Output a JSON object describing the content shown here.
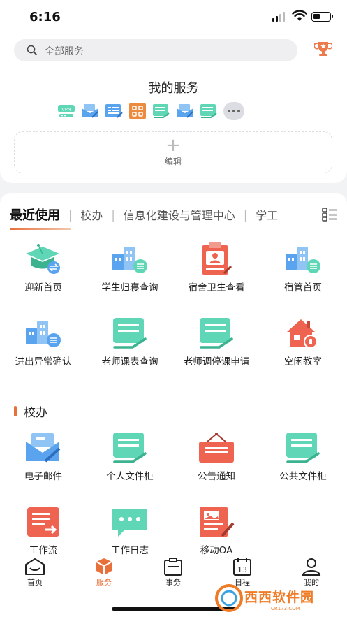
{
  "status_bar": {
    "time": "6:16"
  },
  "search": {
    "placeholder": "全部服务"
  },
  "my_services": {
    "title": "我的服务",
    "icons": [
      "vpn-icon",
      "mail-icon",
      "form-icon",
      "apps-icon",
      "document-icon",
      "mail-icon",
      "document-icon"
    ],
    "edit_label": "编辑"
  },
  "tabs": {
    "items": [
      {
        "label": "最近使用",
        "active": true
      },
      {
        "label": "校办",
        "active": false
      },
      {
        "label": "信息化建设与管理中心",
        "active": false
      },
      {
        "label": "学工",
        "active": false
      }
    ]
  },
  "recent": {
    "items": [
      {
        "label": "迎新首页",
        "icon": "graduation-cap-icon"
      },
      {
        "label": "学生归寝查询",
        "icon": "dormitory-building-icon"
      },
      {
        "label": "宿舍卫生查看",
        "icon": "id-clipboard-icon"
      },
      {
        "label": "宿管首页",
        "icon": "dormitory-building-icon"
      },
      {
        "label": "进出异常确认",
        "icon": "dormitory-building-icon"
      },
      {
        "label": "老师课表查询",
        "icon": "document-hand-icon"
      },
      {
        "label": "老师调停课申请",
        "icon": "document-hand-icon"
      },
      {
        "label": "空闲教室",
        "icon": "house-lock-icon"
      }
    ]
  },
  "xiaoban": {
    "title": "校办",
    "items": [
      {
        "label": "电子邮件",
        "icon": "email-icon"
      },
      {
        "label": "个人文件柜",
        "icon": "document-hand-icon"
      },
      {
        "label": "公告通知",
        "icon": "notice-board-icon"
      },
      {
        "label": "公共文件柜",
        "icon": "document-hand-icon"
      },
      {
        "label": "工作流",
        "icon": "workflow-icon"
      },
      {
        "label": "工作日志",
        "icon": "chat-bubble-icon"
      },
      {
        "label": "移动OA",
        "icon": "edit-document-icon"
      }
    ]
  },
  "nav": {
    "items": [
      {
        "label": "首页",
        "icon": "home-icon",
        "active": false
      },
      {
        "label": "服务",
        "icon": "cube-icon",
        "active": true
      },
      {
        "label": "事务",
        "icon": "clipboard-icon",
        "active": false
      },
      {
        "label": "日程",
        "icon": "calendar-icon",
        "active": false
      },
      {
        "label": "我的",
        "icon": "user-icon",
        "active": false
      }
    ],
    "calendar_day": "13"
  },
  "watermark": {
    "text": "西西软件园",
    "sub": "CR173.COM"
  },
  "colors": {
    "accent": "#e8703a",
    "teal": "#5fd6b6",
    "blue": "#5aa3ee",
    "red": "#ef6450"
  }
}
